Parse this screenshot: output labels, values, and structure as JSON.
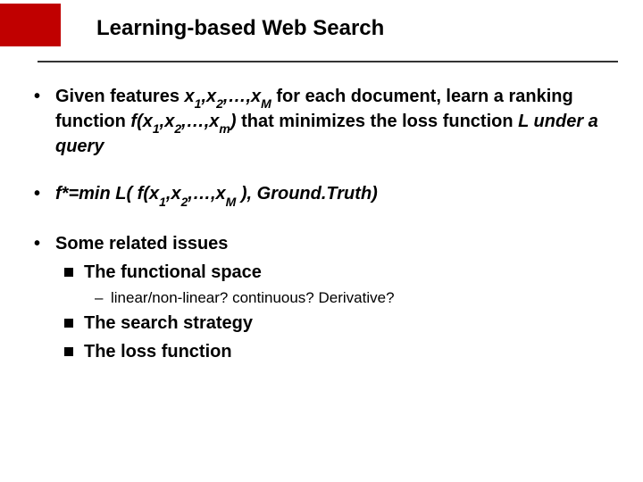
{
  "title": "Learning-based Web Search",
  "b1": {
    "given": "Given ",
    "features": "features",
    "sp1": " ",
    "x": "x",
    "s1": "1",
    "c1": ",",
    "s2": "2",
    "c2": ",…,",
    "sM": "M",
    "foreach": " for each document, learn a ranking function",
    "fx": " f(x",
    "fs1": "1",
    "fc1": ",x",
    "fs2": "2",
    "fc2": ",…,x",
    "fsm": "m",
    "fclose": ")",
    "min": " that minimizes the ",
    "loss": "loss function",
    "Lunder": " L under a query"
  },
  "b2": {
    "fstar": "f*=min L( f(x",
    "s1": "1",
    "c1": ",x",
    "s2": "2",
    "c2": ",…,x",
    "sM": "M",
    "close": " ), Ground.Truth)"
  },
  "b3": {
    "heading": "Some related issues",
    "fspace": "The functional space",
    "fspace_sub": "linear/non-linear? continuous? Derivative?",
    "strategy": "The search strategy",
    "lossfn": "The loss function"
  }
}
